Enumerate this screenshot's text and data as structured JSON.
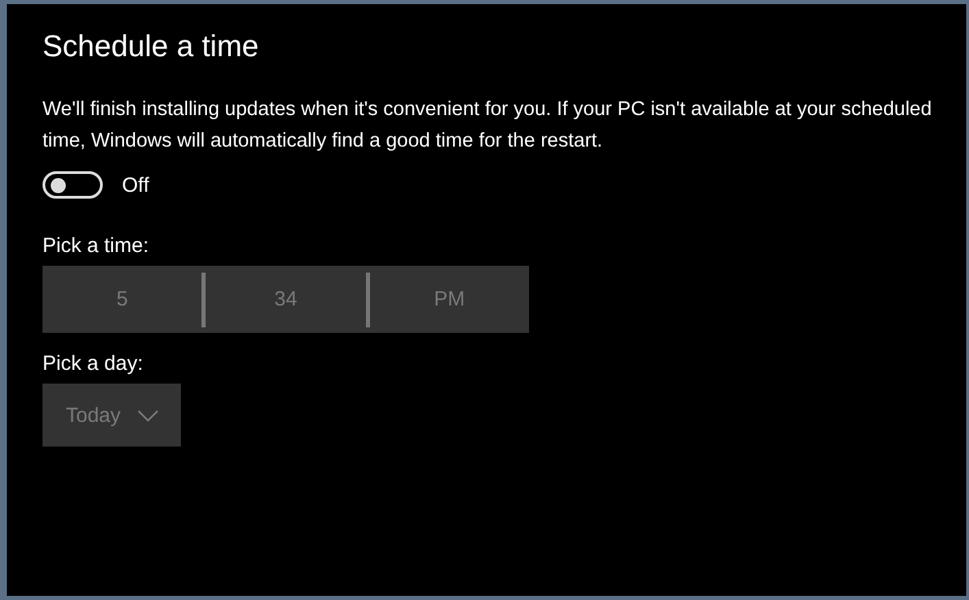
{
  "title": "Schedule a time",
  "description": "We'll finish installing updates when it's convenient for you. If your PC isn't available at your scheduled time, Windows will automatically find a good time for the restart.",
  "toggle": {
    "on": false,
    "label": "Off"
  },
  "time_picker": {
    "label": "Pick a time:",
    "disabled": true,
    "parts": [
      "5",
      "34",
      "PM"
    ]
  },
  "day_picker": {
    "label": "Pick a day:",
    "disabled": true,
    "value": "Today"
  }
}
